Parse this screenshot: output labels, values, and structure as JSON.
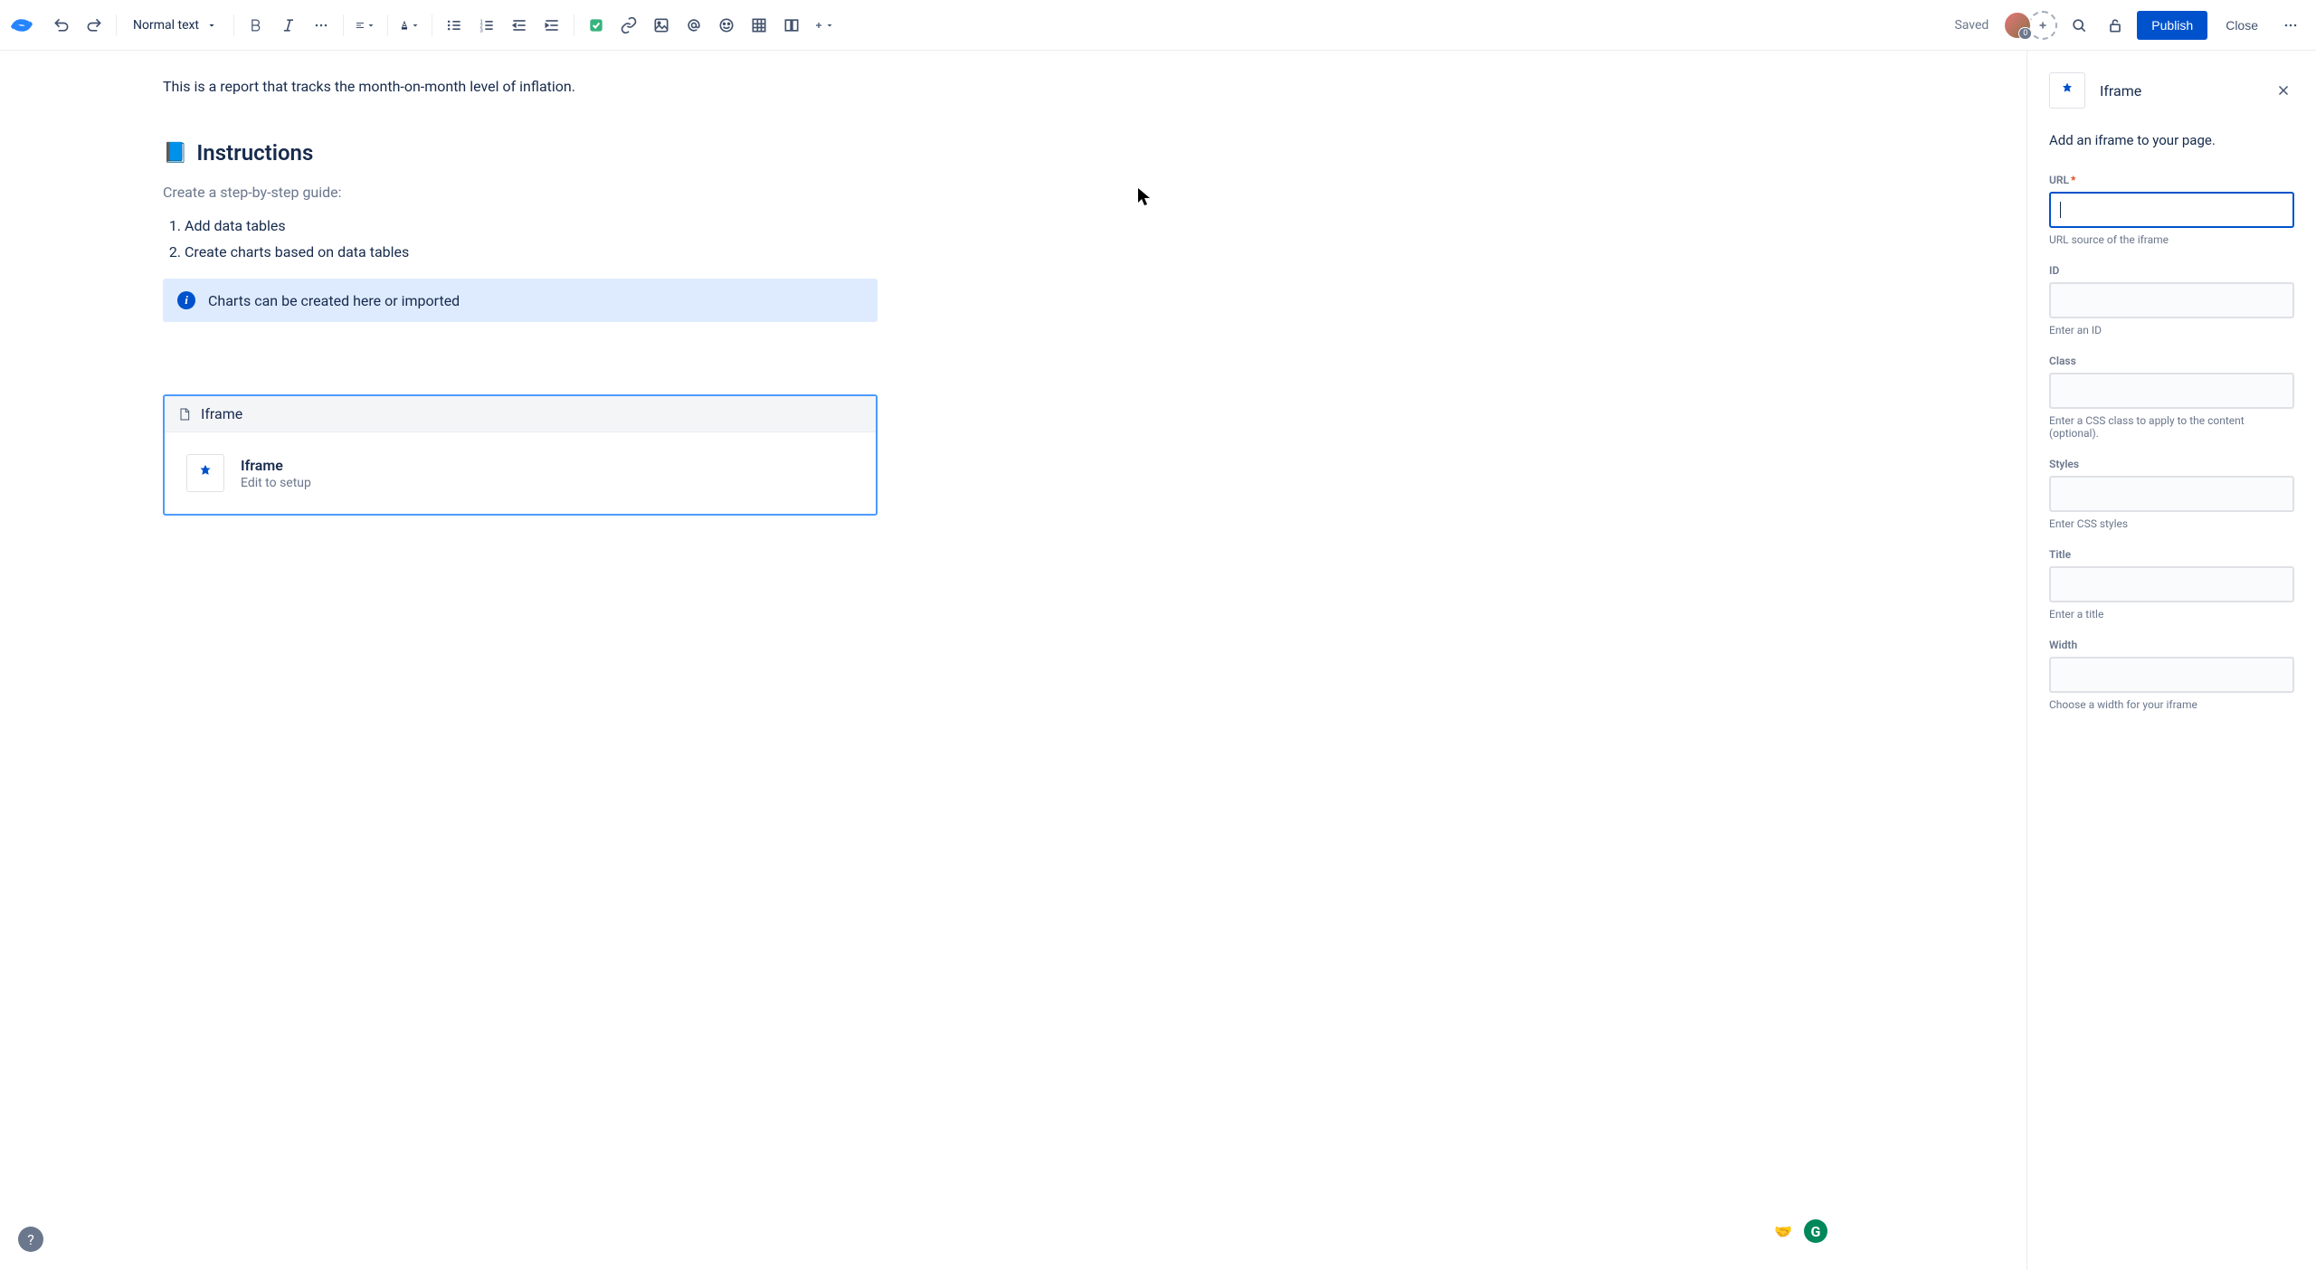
{
  "toolbar": {
    "text_style": "Normal text",
    "saved_label": "Saved",
    "avatar_badge": "0",
    "publish": "Publish",
    "close": "Close"
  },
  "content": {
    "intro": "This is a report that tracks the month-on-month level of inflation.",
    "instructions_heading": "Instructions",
    "instructions_emoji": "📘",
    "subtitle": "Create a step-by-step guide:",
    "steps": [
      "Add data tables",
      "Create charts based on data tables"
    ],
    "info_text": "Charts can be created here or imported",
    "macro": {
      "header": "Iframe",
      "title": "Iframe",
      "sub": "Edit to setup"
    }
  },
  "panel": {
    "title": "Iframe",
    "description": "Add an iframe to your page.",
    "fields": {
      "url": {
        "label": "URL",
        "help": "URL source of the iframe",
        "required": true
      },
      "id": {
        "label": "ID",
        "help": "Enter an ID"
      },
      "class": {
        "label": "Class",
        "help": "Enter a CSS class to apply to the content (optional)."
      },
      "styles": {
        "label": "Styles",
        "help": "Enter CSS styles"
      },
      "title": {
        "label": "Title",
        "help": "Enter a title"
      },
      "width": {
        "label": "Width",
        "help": "Choose a width for your iframe"
      }
    }
  }
}
